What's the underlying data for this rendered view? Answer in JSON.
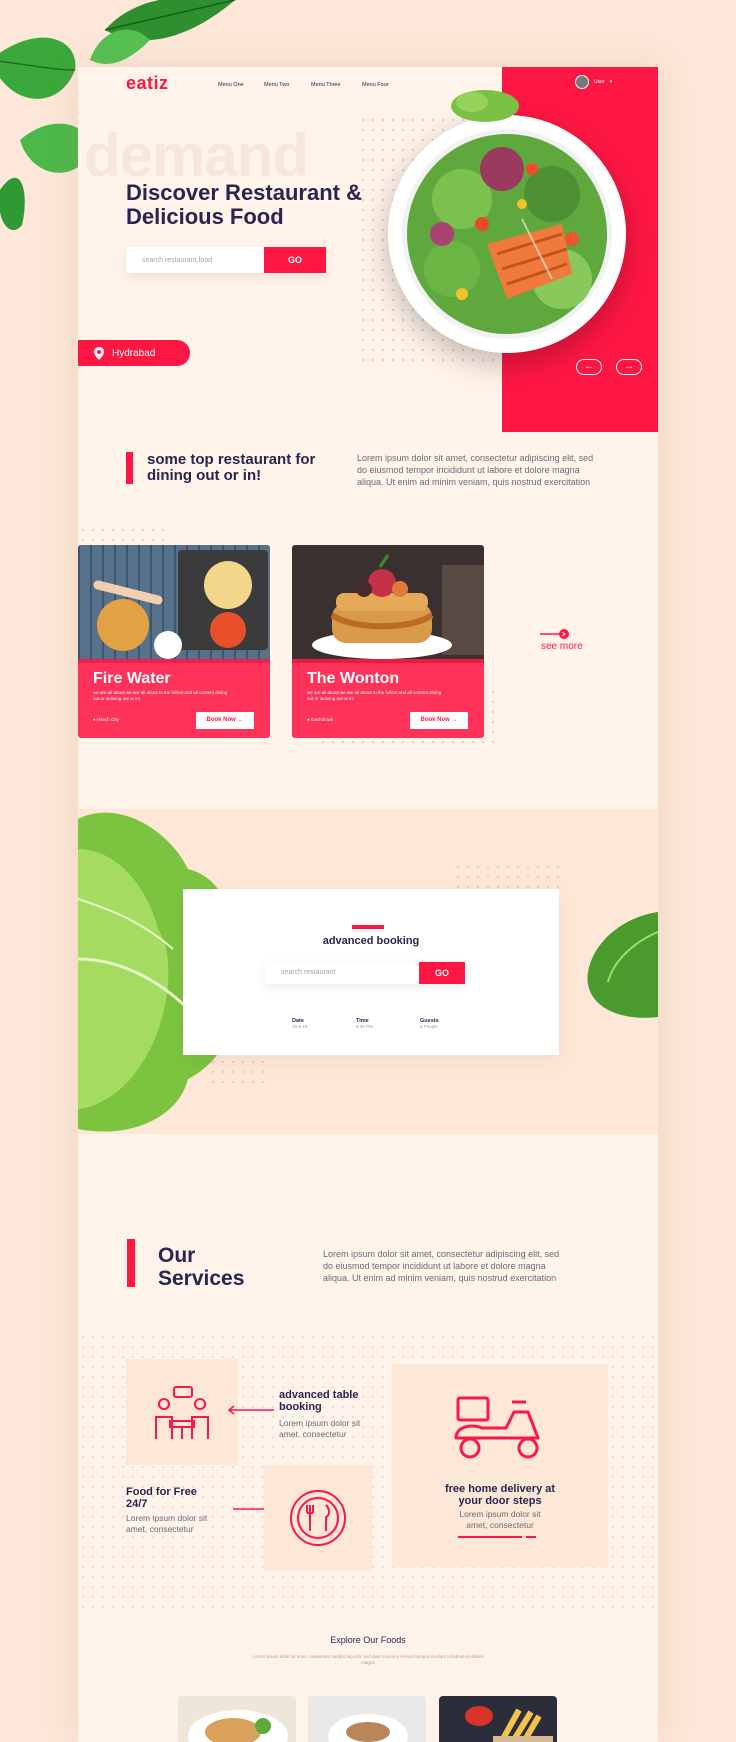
{
  "brand": {
    "logo": "eatiz",
    "accent": "#ff1744",
    "navy": "#2b2452"
  },
  "nav": {
    "items": [
      "Menu One",
      "Menu Two",
      "Menu Three",
      "Menu Four"
    ],
    "user": "User"
  },
  "hero": {
    "watermark": "demand",
    "title": "Discover Restaurant & Delicious Food",
    "search_placeholder": "search restaurant,food",
    "go": "GO",
    "location": "Hydrabad",
    "arrow_prev": "←",
    "arrow_next": "→"
  },
  "top_restaurants": {
    "title": "some top restaurant for dining out or in!",
    "text": "Lorem ipsum dolor sit amet, consectetur adipiscing elit, sed do eiusmod tempor incididunt ut labore et dolore magna aliqua. Ut enim ad minim veniam, quis nostrud exercitation",
    "cards": [
      {
        "name": "Fire Water",
        "desc": "we are all about we are all about to the fullest and all content dining out or indining out or in!",
        "location": "Hitech City",
        "button": "Book Now"
      },
      {
        "name": "The Wonton",
        "desc": "we are all about we are all about to the fullest and all content dining out or indining out or in!",
        "location": "Gachibowli",
        "button": "Book Now"
      }
    ],
    "see_more": "see more"
  },
  "booking": {
    "title": "advanced booking",
    "search_placeholder": "search restaurant",
    "go": "GO",
    "fields": [
      {
        "label": "Date",
        "value": "15-6-19"
      },
      {
        "label": "Time",
        "value": "6:30 PM"
      },
      {
        "label": "Guests",
        "value": "2 People"
      }
    ]
  },
  "services": {
    "title_line1": "Our",
    "title_line2": "Services",
    "text": "Lorem ipsum dolor sit amet, consectetur adipiscing elit, sed do eiusmod tempor incididunt ut labore et dolore magna aliqua. Ut enim ad minim veniam, quis nostrud exercitation",
    "items": [
      {
        "title": "advanced table booking",
        "text": "Lorem ipsum dolor sit amet, consectetur"
      },
      {
        "title": "Food for Free 24/7",
        "text": "Lorem ipsum dolor sit amet, consectetur"
      },
      {
        "title": "free home delivery at your door steps",
        "text": "Lorem ipsum dolor sit amet, consectetur"
      }
    ]
  },
  "explore": {
    "title": "Explore Our Foods",
    "text": "Lorem ipsum dolor sit amet, consetetur sadipscing elitr, sed diam nonumy eirmod tempor invidunt ut labore et dolore magna"
  }
}
